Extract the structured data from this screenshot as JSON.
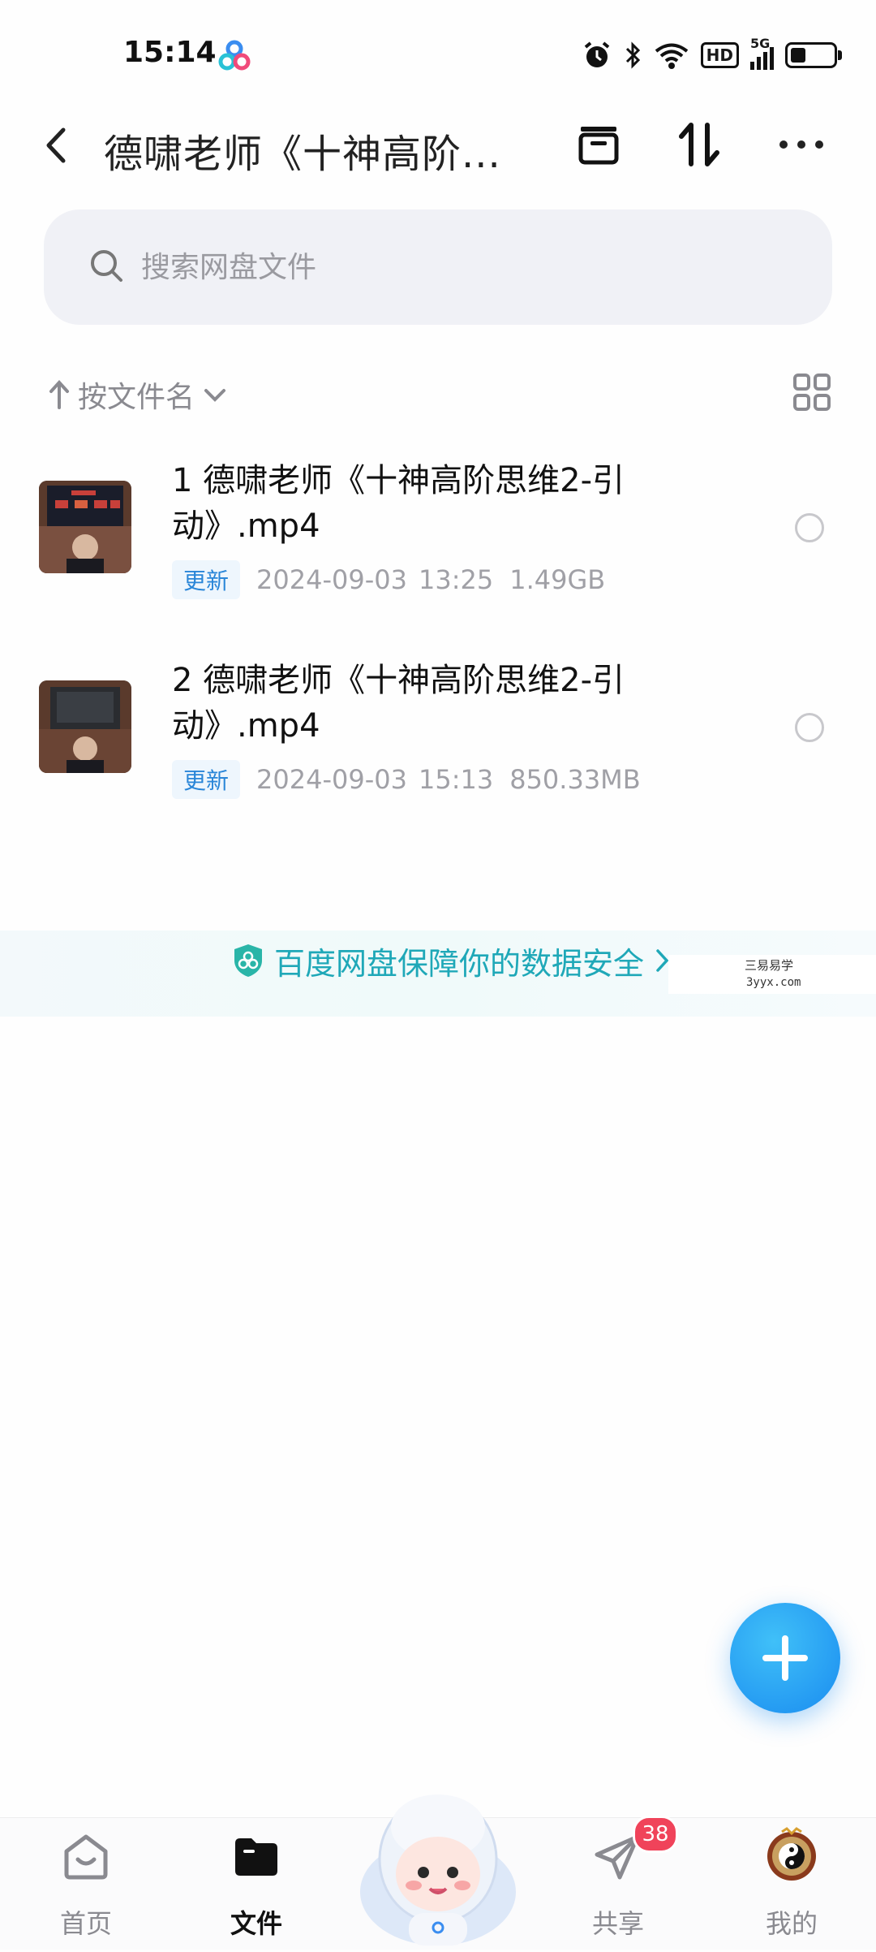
{
  "status_bar": {
    "time": "15:14",
    "network": "5G",
    "hd_label": "HD"
  },
  "header": {
    "title": "德啸老师《十神高阶...",
    "back_icon": "back-arrow-icon"
  },
  "search": {
    "placeholder": "搜索网盘文件"
  },
  "sort": {
    "label": "按文件名"
  },
  "files": [
    {
      "name": "1 德啸老师《十神高阶思维2-引动》.mp4",
      "badge": "更新",
      "date": "2024-09-03",
      "time": "13:25",
      "size": "1.49GB"
    },
    {
      "name": "2 德啸老师《十神高阶思维2-引动》.mp4",
      "badge": "更新",
      "date": "2024-09-03",
      "time": "15:13",
      "size": "850.33MB"
    }
  ],
  "banner": {
    "text": "百度网盘保障你的数据安全"
  },
  "watermark": {
    "line1": "三易易学",
    "line2": "3yyx.com"
  },
  "nav": {
    "items": [
      {
        "label": "首页"
      },
      {
        "label": "文件"
      },
      {
        "label": "共享"
      },
      {
        "label": "我的"
      }
    ],
    "share_badge": "38"
  },
  "colors": {
    "accent": "#1a8cf0",
    "banner_text": "#1fa8b8",
    "badge_bg": "#eef6fd",
    "badge_text": "#2a86d8",
    "notify": "#f0435a"
  }
}
